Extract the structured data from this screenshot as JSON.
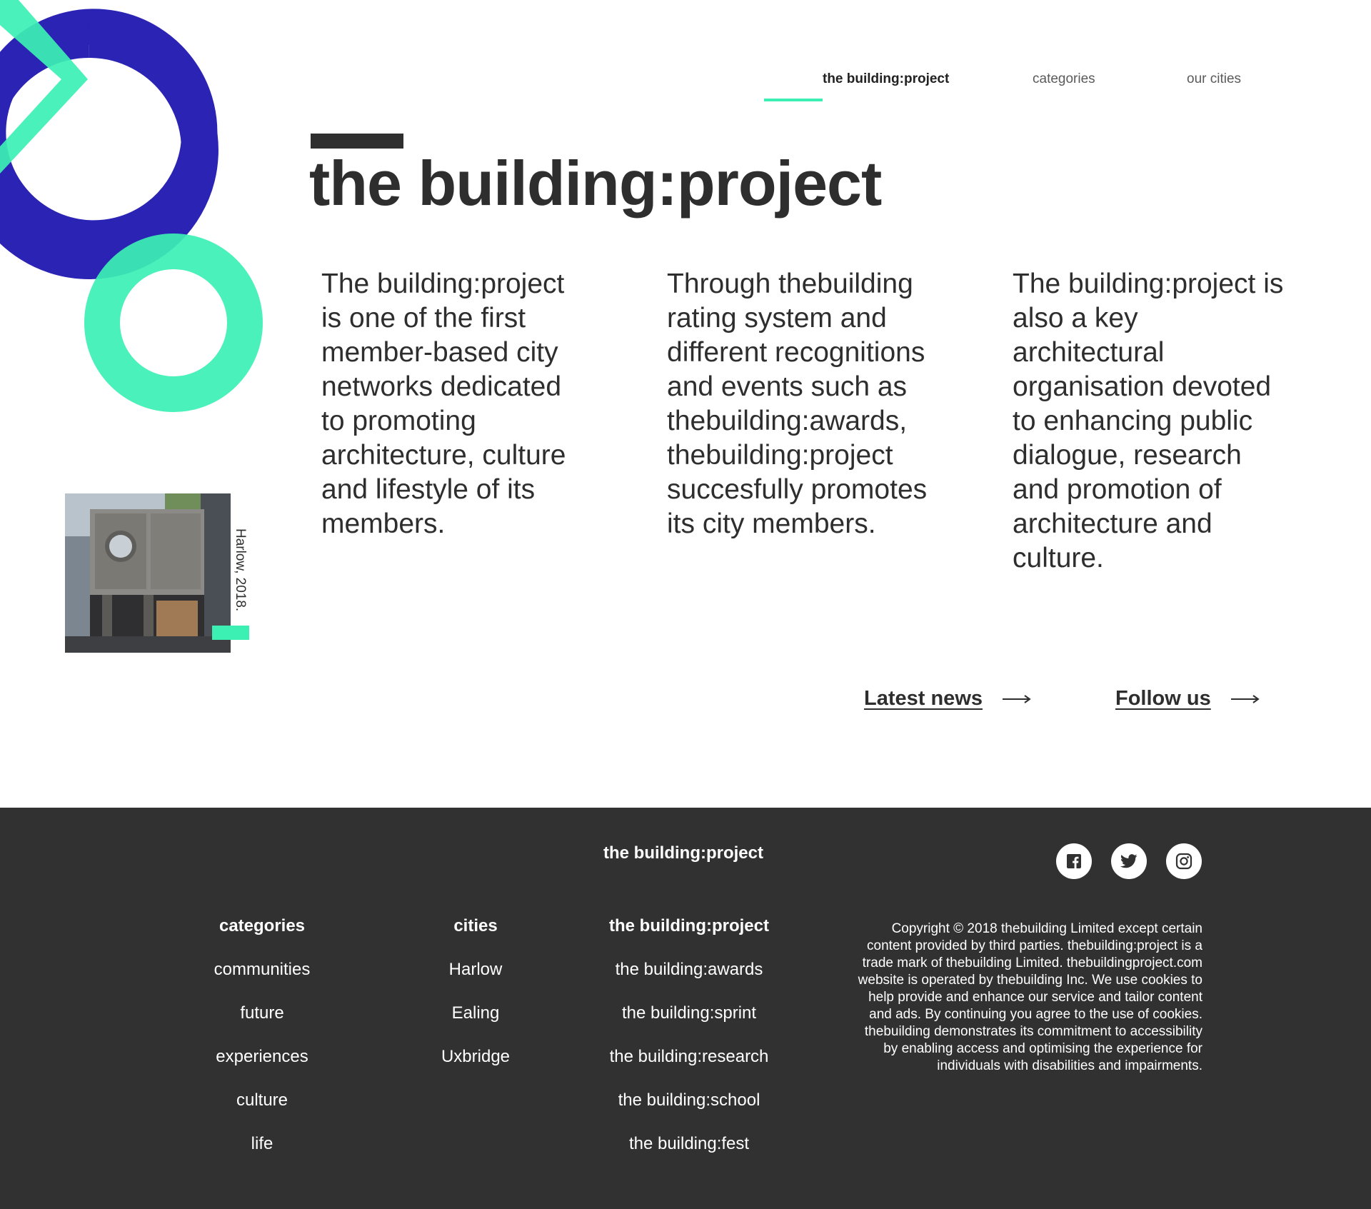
{
  "nav": {
    "items": [
      {
        "label": "the building:project",
        "active": true
      },
      {
        "label": "categories",
        "active": false
      },
      {
        "label": "our cities",
        "active": false
      }
    ]
  },
  "header": {
    "title_bold": "the building:",
    "title_regular": "project"
  },
  "intro": {
    "columns": [
      "The building:project is one of the first member-based city networks dedicated to promoting architecture, culture and lifestyle of its members.",
      "Through thebuilding rating system and different recognitions and events such as thebuilding:awards, thebuilding:project succesfully promotes its city members.",
      "The building:project is also a key architectural organisation devoted to enhancing public dialogue, research and promotion of architecture and culture."
    ]
  },
  "photo": {
    "caption": "Harlow, 2018."
  },
  "links": {
    "latest_news": "Latest news",
    "follow_us": "Follow us"
  },
  "footer": {
    "brand": "the building:project",
    "social": [
      "facebook-icon",
      "twitter-icon",
      "instagram-icon"
    ],
    "categories": {
      "heading": "categories",
      "items": [
        "communities",
        "future",
        "experiences",
        "culture",
        "life"
      ]
    },
    "cities": {
      "heading": "cities",
      "items": [
        "Harlow",
        "Ealing",
        "Uxbridge"
      ]
    },
    "project": {
      "heading": "the building:project",
      "items": [
        "the building:awards",
        "the building:sprint",
        "the building:research",
        "the building:school",
        "the building:fest"
      ]
    },
    "copyright": "Copyright © 2018 thebuilding Limited except certain content provided by third parties. thebuilding:project is a trade mark of thebuilding Limited. thebuildingproject.com website is operated by thebuilding Inc.  We use cookies to help provide and enhance our service and tailor content and ads. By continuing you agree to the use of cookies. thebuilding demonstrates its commitment to accessibility by enabling access and optimising the experience for individuals with disabilities and impairments."
  },
  "colors": {
    "accent": "#3cf0b4",
    "brand_blue": "#2b23b4",
    "text": "#2e2e2e",
    "footer_bg": "#313131"
  }
}
